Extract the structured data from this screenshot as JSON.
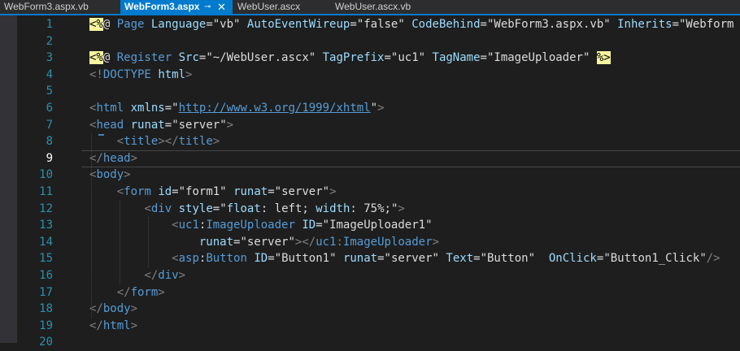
{
  "tabs": [
    {
      "label": "WebForm3.aspx.vb",
      "active": false
    },
    {
      "label": "WebForm3.aspx",
      "active": true,
      "pin_icon": "pin-icon",
      "close_icon": "close-icon"
    },
    {
      "label": "WebUser.ascx",
      "active": false
    },
    {
      "label": "WebUser.ascx.vb",
      "active": false
    }
  ],
  "tab_glyphs": {
    "pin": "⊸",
    "close": "✕"
  },
  "editor": {
    "current_line": 9,
    "line_numbers": [
      "1",
      "2",
      "3",
      "4",
      "5",
      "6",
      "7",
      "8",
      "9",
      "10",
      "11",
      "12",
      "13",
      "14",
      "15",
      "16",
      "17",
      "18",
      "19",
      "20"
    ],
    "lines": [
      [
        [
          "dir-hl",
          "<%"
        ],
        [
          "text",
          "@ "
        ],
        [
          "dir-name",
          "Page"
        ],
        [
          "text",
          " "
        ],
        [
          "attr",
          "Language"
        ],
        [
          "text",
          "="
        ],
        [
          "text",
          "\"vb\""
        ],
        [
          "text",
          " "
        ],
        [
          "attr",
          "AutoEventWireup"
        ],
        [
          "text",
          "="
        ],
        [
          "text",
          "\"false\""
        ],
        [
          "text",
          " "
        ],
        [
          "attr",
          "CodeBehind"
        ],
        [
          "text",
          "="
        ],
        [
          "text",
          "\"WebForm3.aspx.vb\""
        ],
        [
          "text",
          " "
        ],
        [
          "attr",
          "Inherits"
        ],
        [
          "text",
          "="
        ],
        [
          "text",
          "\"Webform"
        ]
      ],
      [],
      [
        [
          "dir-hl",
          "<%"
        ],
        [
          "text",
          "@ "
        ],
        [
          "dir-name",
          "Register"
        ],
        [
          "text",
          " "
        ],
        [
          "attr",
          "Src"
        ],
        [
          "text",
          "="
        ],
        [
          "text",
          "\"~/WebUser.ascx\""
        ],
        [
          "text",
          " "
        ],
        [
          "attr",
          "TagPrefix"
        ],
        [
          "text",
          "="
        ],
        [
          "text",
          "\"uc1\""
        ],
        [
          "text",
          " "
        ],
        [
          "attr",
          "TagName"
        ],
        [
          "text",
          "="
        ],
        [
          "text",
          "\"ImageUploader\""
        ],
        [
          "text",
          " "
        ],
        [
          "dir-hl",
          "%>"
        ]
      ],
      [
        [
          "delim",
          "<!"
        ],
        [
          "tag",
          "DOCTYPE"
        ],
        [
          "text",
          " "
        ],
        [
          "attr",
          "html"
        ],
        [
          "delim",
          ">"
        ]
      ],
      [],
      [
        [
          "delim",
          "<"
        ],
        [
          "tag",
          "html"
        ],
        [
          "text",
          " "
        ],
        [
          "attr",
          "xmlns"
        ],
        [
          "text",
          "=\""
        ],
        [
          "url",
          "http://www.w3.org/1999/xhtml"
        ],
        [
          "text",
          "\""
        ],
        [
          "delim",
          ">"
        ]
      ],
      [
        [
          "delim",
          "<"
        ],
        [
          "tag",
          "head"
        ],
        [
          "text",
          " "
        ],
        [
          "attr",
          "runat"
        ],
        [
          "text",
          "="
        ],
        [
          "text",
          "\"server\""
        ],
        [
          "delim",
          ">"
        ]
      ],
      [
        [
          "text",
          "    "
        ],
        [
          "delim",
          "<"
        ],
        [
          "tag",
          "title"
        ],
        [
          "delim",
          "></"
        ],
        [
          "tag",
          "title"
        ],
        [
          "delim",
          ">"
        ]
      ],
      [
        [
          "delim",
          "</"
        ],
        [
          "tag",
          "head"
        ],
        [
          "delim",
          ">"
        ]
      ],
      [
        [
          "delim",
          "<"
        ],
        [
          "tag",
          "body"
        ],
        [
          "delim",
          ">"
        ]
      ],
      [
        [
          "text",
          "    "
        ],
        [
          "delim",
          "<"
        ],
        [
          "tag",
          "form"
        ],
        [
          "text",
          " "
        ],
        [
          "attr",
          "id"
        ],
        [
          "text",
          "="
        ],
        [
          "text",
          "\"form1\""
        ],
        [
          "text",
          " "
        ],
        [
          "attr",
          "runat"
        ],
        [
          "text",
          "="
        ],
        [
          "text",
          "\"server\""
        ],
        [
          "delim",
          ">"
        ]
      ],
      [
        [
          "text",
          "        "
        ],
        [
          "delim",
          "<"
        ],
        [
          "tag",
          "div"
        ],
        [
          "text",
          " "
        ],
        [
          "attr",
          "style"
        ],
        [
          "text",
          "="
        ],
        [
          "text",
          "\""
        ],
        [
          "attr",
          "float"
        ],
        [
          "text",
          ": "
        ],
        [
          "text",
          "left"
        ],
        [
          "text",
          "; "
        ],
        [
          "attr",
          "width"
        ],
        [
          "text",
          ": "
        ],
        [
          "text",
          "75%"
        ],
        [
          "text",
          ";\""
        ],
        [
          "delim",
          ">"
        ]
      ],
      [
        [
          "text",
          "            "
        ],
        [
          "delim",
          "<"
        ],
        [
          "tag",
          "uc1"
        ],
        [
          "text",
          ":"
        ],
        [
          "tag",
          "ImageUploader"
        ],
        [
          "text",
          " "
        ],
        [
          "attr",
          "ID"
        ],
        [
          "text",
          "="
        ],
        [
          "text",
          "\"ImageUploader1\""
        ]
      ],
      [
        [
          "text",
          "                "
        ],
        [
          "attr",
          "runat"
        ],
        [
          "text",
          "="
        ],
        [
          "text",
          "\"server\""
        ],
        [
          "delim",
          "></"
        ],
        [
          "tag",
          "uc1"
        ],
        [
          "delim",
          ":"
        ],
        [
          "tag",
          "ImageUploader"
        ],
        [
          "delim",
          ">"
        ]
      ],
      [
        [
          "text",
          "            "
        ],
        [
          "delim",
          "<"
        ],
        [
          "tag",
          "asp"
        ],
        [
          "text",
          ":"
        ],
        [
          "tag",
          "Button"
        ],
        [
          "text",
          " "
        ],
        [
          "attr",
          "ID"
        ],
        [
          "text",
          "="
        ],
        [
          "text",
          "\"Button1\""
        ],
        [
          "text",
          " "
        ],
        [
          "attr",
          "runat"
        ],
        [
          "text",
          "="
        ],
        [
          "text",
          "\"server\""
        ],
        [
          "text",
          " "
        ],
        [
          "attr",
          "Text"
        ],
        [
          "text",
          "="
        ],
        [
          "text",
          "\"Button\""
        ],
        [
          "text",
          "  "
        ],
        [
          "attr",
          "OnClick"
        ],
        [
          "text",
          "="
        ],
        [
          "text",
          "\"Button1_Click\""
        ],
        [
          "delim",
          "/>"
        ]
      ],
      [
        [
          "text",
          "        "
        ],
        [
          "delim",
          "</"
        ],
        [
          "tag",
          "div"
        ],
        [
          "delim",
          ">"
        ]
      ],
      [
        [
          "text",
          "    "
        ],
        [
          "delim",
          "</"
        ],
        [
          "tag",
          "form"
        ],
        [
          "delim",
          ">"
        ]
      ],
      [
        [
          "delim",
          "</"
        ],
        [
          "tag",
          "body"
        ],
        [
          "delim",
          ">"
        ]
      ],
      [
        [
          "delim",
          "</"
        ],
        [
          "tag",
          "html"
        ],
        [
          "delim",
          ">"
        ]
      ],
      []
    ]
  },
  "colors": {
    "tab_active_bg": "#007acc",
    "line_number": "#2b91af",
    "tag": "#569cd6",
    "attribute": "#9cdcfe",
    "text": "#dcdcdc",
    "directive_highlight": "#f5f5a0"
  }
}
